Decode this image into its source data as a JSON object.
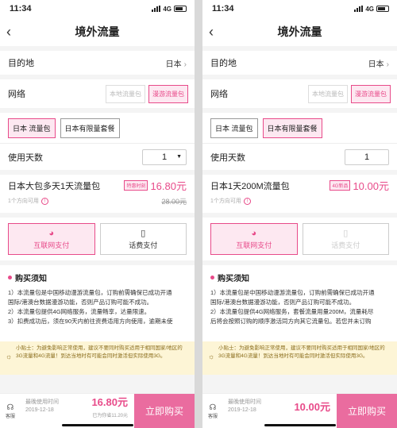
{
  "left": {
    "status": {
      "time": "11:34",
      "network": "4G"
    },
    "nav": {
      "title": "境外流量"
    },
    "destination": {
      "label": "目的地",
      "value": "日本"
    },
    "network": {
      "label": "网络",
      "options": [
        "本地流量包",
        "漫游流量包"
      ]
    },
    "packages": [
      "日本 流量包",
      "日本有限量套餐"
    ],
    "days": {
      "label": "使用天数",
      "value": "1"
    },
    "product": {
      "name": "日本大包多天1天流量包",
      "tag": "特惠时刻",
      "price": "16.80元",
      "original": "28.00元",
      "sub": "1个方向可用"
    },
    "payment": {
      "internet": "互联网支付",
      "phone_bill": "话费支付"
    },
    "notice": {
      "title": "购买须知",
      "lines": [
        "1）本流量包是中国移动漫游流量包，订购前需确保已成功开通",
        "国际/港澳台数据漫游功能，否则产品订购可能不成功。",
        "2）本流量包提供4G网络服务，流量畅享，达量限速。",
        "3）扣费成功后，须在90天内前往资费适用方向使用，逾期未使"
      ]
    },
    "tip": "小贴士：为避免影响正常使用，建议不要同时购买适用于相同国家/地区的3G流量和4G流量！到达当地时有可能会同时激活但实际使用3G。",
    "bottom": {
      "service": "客服",
      "latest_label": "最晚使用时间",
      "latest_date": "2019-12-18",
      "price": "16.80元",
      "saved": "已为你省11.20元",
      "buy": "立即购买"
    }
  },
  "right": {
    "status": {
      "time": "11:34",
      "network": "4G"
    },
    "nav": {
      "title": "境外流量"
    },
    "destination": {
      "label": "目的地",
      "value": "日本"
    },
    "network": {
      "label": "网络",
      "options": [
        "本地流量包",
        "漫游流量包"
      ]
    },
    "packages": [
      "日本 流量包",
      "日本有限量套餐"
    ],
    "days": {
      "label": "使用天数",
      "value": "1"
    },
    "product": {
      "name": "日本1天200M流量包",
      "tag": "4G新品",
      "price": "10.00元",
      "sub": "1个方向可用"
    },
    "payment": {
      "internet": "互联网支付",
      "phone_bill": "话费支付"
    },
    "notice": {
      "title": "购买须知",
      "lines": [
        "1）本流量包是中国移动漫游流量包，订购前需确保已成功开通",
        "国际/港澳台数据漫游功能，否则产品订购可能不成功。",
        "2）本流量包提供4G网络服务，套餐流量用量200M，流量耗尽",
        "后将会按照订购的顺序激活同方向其它流量包。若您并未订购"
      ]
    },
    "tip": "小贴士：为避免影响正常使用，建议不要同时购买适用于相同国家/地区的3G流量和4G流量！到达当地时有可能会同时激活但实际使用3G。",
    "bottom": {
      "service": "客服",
      "latest_label": "最晚使用时间",
      "latest_date": "2019-12-18",
      "price": "10.00元",
      "buy": "立即购买"
    }
  }
}
